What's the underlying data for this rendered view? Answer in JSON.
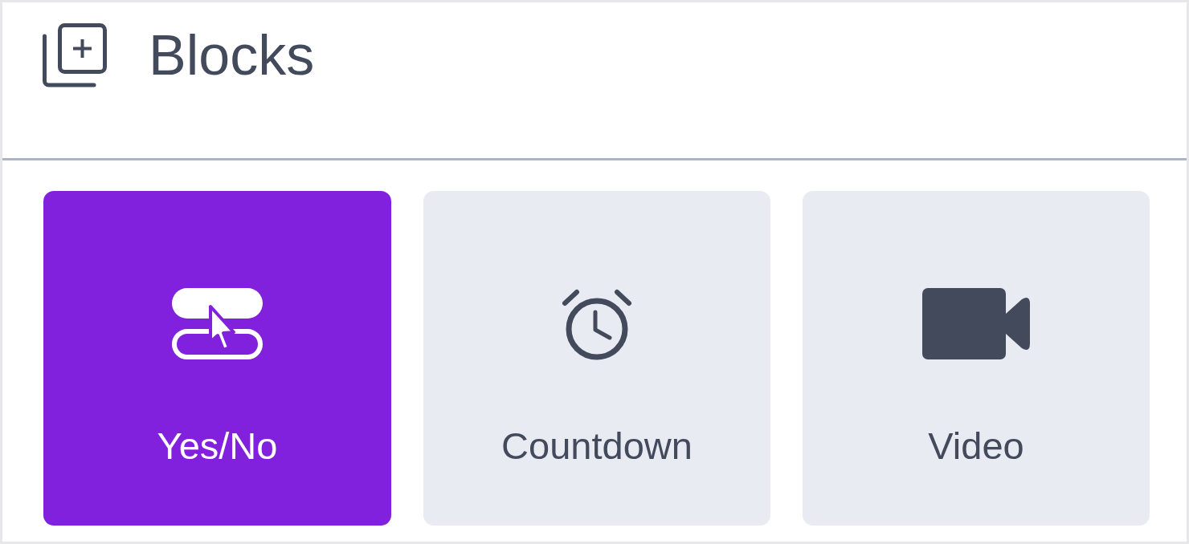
{
  "panel": {
    "title": "Blocks"
  },
  "blocks": [
    {
      "label": "Yes/No",
      "kind": "choice",
      "selected": true
    },
    {
      "label": "Countdown",
      "kind": "countdown",
      "selected": false
    },
    {
      "label": "Video",
      "kind": "video",
      "selected": false
    }
  ]
}
